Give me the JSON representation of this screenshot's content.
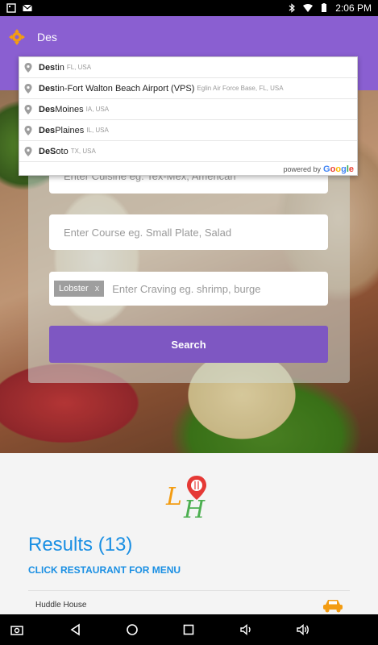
{
  "status_bar": {
    "time": "2:06 PM"
  },
  "app_bar": {
    "search_text": "Des"
  },
  "suggestions": [
    {
      "match": "Des",
      "rest": "tin",
      "sub": "FL, USA"
    },
    {
      "match": "Des",
      "rest": "tin-Fort Walton Beach Airport (VPS)",
      "sub": "Eglin Air Force Base, FL, USA"
    },
    {
      "match": "Des",
      "rest": " Moines",
      "sub": "IA, USA"
    },
    {
      "match": "Des",
      "rest": " Plaines",
      "sub": "IL, USA"
    },
    {
      "match": "DeS",
      "rest": "oto",
      "sub": "TX, USA"
    }
  ],
  "powered_by": {
    "prefix": "powered by",
    "brand": "Google"
  },
  "form": {
    "cuisine_placeholder": "Enter Cuisine eg. Tex-Mex, American",
    "course_placeholder": "Enter Course eg. Small Plate, Salad",
    "craving_chip": "Lobster",
    "craving_chip_remove": "x",
    "craving_placeholder": "Enter Craving eg. shrimp, burge",
    "search_label": "Search"
  },
  "results": {
    "title": "Results (13)",
    "subtitle": "CLICK RESTAURANT FOR MENU",
    "first_restaurant": "Huddle House"
  },
  "colors": {
    "primary": "#8a5fd1",
    "button": "#7e57c2",
    "link_blue": "#1a8fe3"
  }
}
